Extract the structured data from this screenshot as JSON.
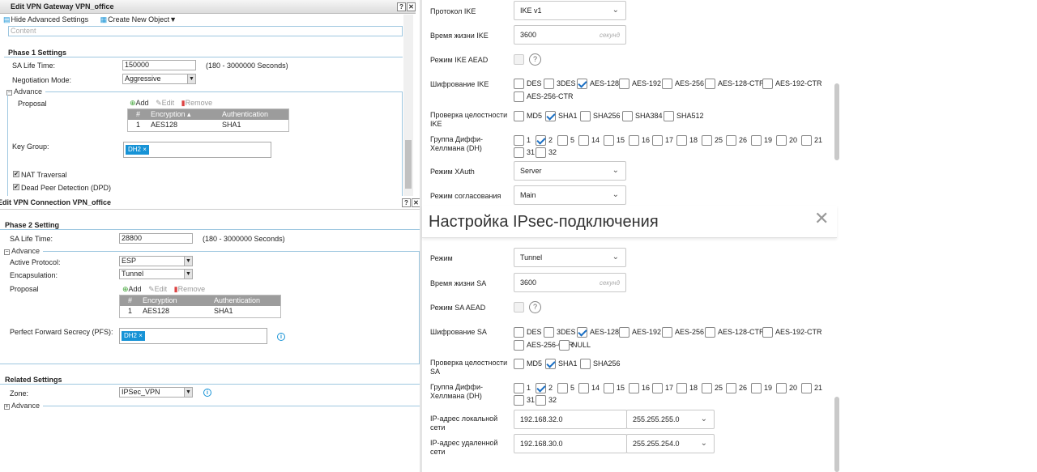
{
  "gw": {
    "title": "Edit VPN Gateway VPN_office",
    "hide_advanced": "Hide Advanced Settings",
    "create_new": "Create New Object▼",
    "content_placeholder": "Content",
    "phase1": "Phase 1 Settings",
    "sa_life_label": "SA Life Time:",
    "sa_life_value": "150000",
    "sa_life_hint": "(180 - 3000000 Seconds)",
    "neg_mode_label": "Negotiation Mode:",
    "neg_mode_value": "Aggressive",
    "advance": "Advance",
    "proposal_label": "Proposal",
    "add": "Add",
    "edit": "Edit",
    "remove": "Remove",
    "col_num": "#",
    "col_enc": "Encryption ▴",
    "col_auth": "Authentication",
    "row": {
      "num": "1",
      "enc": "AES128",
      "auth": "SHA1"
    },
    "key_group_label": "Key Group:",
    "key_group_tag": "DH2 ×",
    "nat": "NAT Traversal",
    "dpd": "Dead Peer Detection (DPD)"
  },
  "conn": {
    "title": "Edit VPN Connection VPN_office",
    "phase2": "Phase 2 Setting",
    "sa_life_label": "SA Life Time:",
    "sa_life_value": "28800",
    "sa_life_hint": "(180 - 3000000 Seconds)",
    "advance": "Advance",
    "proto_label": "Active Protocol:",
    "proto_value": "ESP",
    "encap_label": "Encapsulation:",
    "encap_value": "Tunnel",
    "proposal_label": "Proposal",
    "add": "Add",
    "edit": "Edit",
    "remove": "Remove",
    "col_num": "#",
    "col_enc": "Encryption",
    "col_auth": "Authentication",
    "row": {
      "num": "1",
      "enc": "AES128",
      "auth": "SHA1"
    },
    "pfs_label": "Perfect Forward Secrecy (PFS):",
    "pfs_tag": "DH2 ×",
    "related": "Related Settings",
    "zone_label": "Zone:",
    "zone_value": "IPSec_VPN",
    "advance2": "Advance"
  },
  "ike": {
    "proto_label": "Протокол IKE",
    "proto_value": "IKE v1",
    "life_label": "Время жизни IKE",
    "life_value": "3600",
    "life_suffix": "секунд",
    "aead_label": "Режим IKE AEAD",
    "enc_label": "Шифрование IKE",
    "enc": [
      {
        "t": "DES",
        "on": false
      },
      {
        "t": "3DES",
        "on": false
      },
      {
        "t": "AES-128",
        "on": true
      },
      {
        "t": "AES-192",
        "on": false
      },
      {
        "t": "AES-256",
        "on": false
      },
      {
        "t": "AES-128-CTR",
        "on": false
      },
      {
        "t": "AES-192-CTR",
        "on": false
      },
      {
        "t": "AES-256-CTR",
        "on": false
      }
    ],
    "int_label": "Проверка целостности IKE",
    "int": [
      {
        "t": "MD5",
        "on": false
      },
      {
        "t": "SHA1",
        "on": true
      },
      {
        "t": "SHA256",
        "on": false
      },
      {
        "t": "SHA384",
        "on": false
      },
      {
        "t": "SHA512",
        "on": false
      }
    ],
    "dh_label": "Группа Диффи-Хеллмана (DH)",
    "dh": [
      {
        "t": "1",
        "on": false
      },
      {
        "t": "2",
        "on": true
      },
      {
        "t": "5",
        "on": false
      },
      {
        "t": "14",
        "on": false
      },
      {
        "t": "15",
        "on": false
      },
      {
        "t": "16",
        "on": false
      },
      {
        "t": "17",
        "on": false
      },
      {
        "t": "18",
        "on": false
      },
      {
        "t": "25",
        "on": false
      },
      {
        "t": "26",
        "on": false
      },
      {
        "t": "19",
        "on": false
      },
      {
        "t": "20",
        "on": false
      },
      {
        "t": "21",
        "on": false
      },
      {
        "t": "31",
        "on": false
      },
      {
        "t": "32",
        "on": false
      }
    ],
    "xauth_label": "Режим XAuth",
    "xauth_value": "Server",
    "neg_label": "Режим согласования",
    "neg_value": "Main"
  },
  "ipsec": {
    "heading": "Настройка IPsec-подключения",
    "mode_label": "Режим",
    "mode_value": "Tunnel",
    "life_label": "Время жизни SA",
    "life_value": "3600",
    "life_suffix": "секунд",
    "aead_label": "Режим SA AEAD",
    "enc_label": "Шифрование SA",
    "enc": [
      {
        "t": "DES",
        "on": false
      },
      {
        "t": "3DES",
        "on": false
      },
      {
        "t": "AES-128",
        "on": true
      },
      {
        "t": "AES-192",
        "on": false
      },
      {
        "t": "AES-256",
        "on": false
      },
      {
        "t": "AES-128-CTR",
        "on": false
      },
      {
        "t": "AES-192-CTR",
        "on": false
      },
      {
        "t": "AES-256-CTR",
        "on": false
      },
      {
        "t": "NULL",
        "on": false
      }
    ],
    "int_label": "Проверка целостности SA",
    "int": [
      {
        "t": "MD5",
        "on": false
      },
      {
        "t": "SHA1",
        "on": true
      },
      {
        "t": "SHA256",
        "on": false
      }
    ],
    "dh_label": "Группа Диффи-Хеллмана (DH)",
    "dh": [
      {
        "t": "1",
        "on": false
      },
      {
        "t": "2",
        "on": true
      },
      {
        "t": "5",
        "on": false
      },
      {
        "t": "14",
        "on": false
      },
      {
        "t": "15",
        "on": false
      },
      {
        "t": "16",
        "on": false
      },
      {
        "t": "17",
        "on": false
      },
      {
        "t": "18",
        "on": false
      },
      {
        "t": "25",
        "on": false
      },
      {
        "t": "26",
        "on": false
      },
      {
        "t": "19",
        "on": false
      },
      {
        "t": "20",
        "on": false
      },
      {
        "t": "21",
        "on": false
      },
      {
        "t": "31",
        "on": false
      },
      {
        "t": "32",
        "on": false
      }
    ],
    "local_label": "IP-адрес локальной сети",
    "local_ip": "192.168.32.0",
    "local_mask": "255.255.255.0",
    "remote_label": "IP-адрес удаленной сети",
    "remote_ip": "192.168.30.0",
    "remote_mask": "255.255.254.0"
  },
  "colors": {
    "accent": "#1793d6",
    "check": "#1a6fc4",
    "table_header": "#9c9c9c"
  }
}
